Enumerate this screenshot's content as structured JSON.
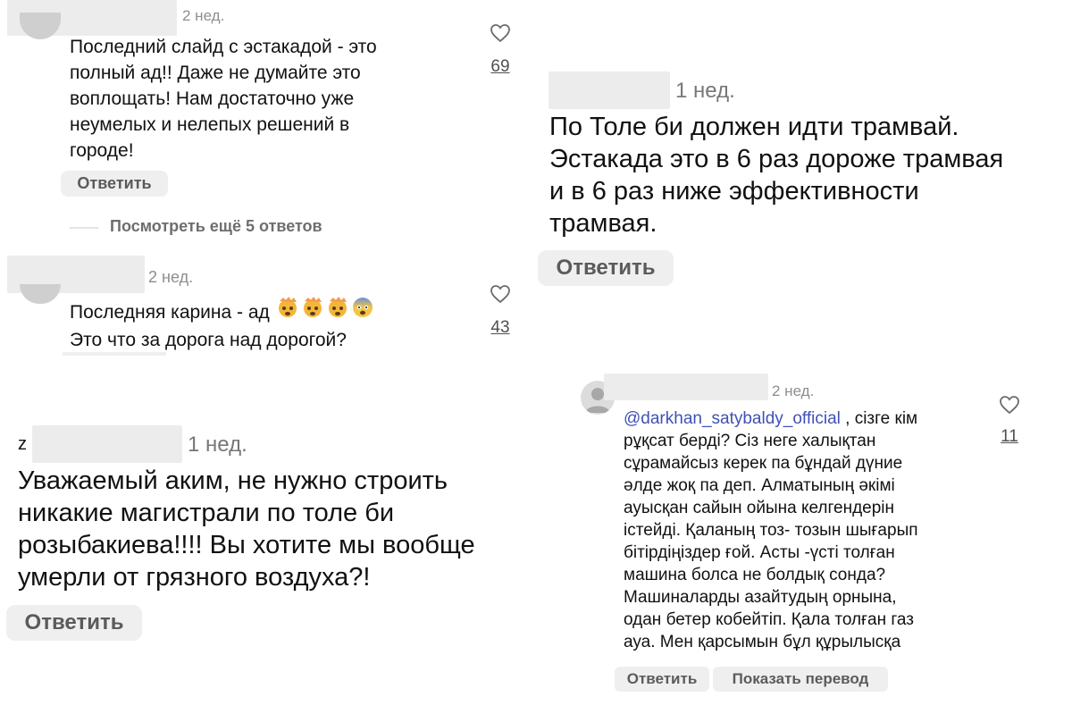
{
  "c1": {
    "time": "2 нед.",
    "lines": [
      "Последний слайд с эстакадой - это",
      "полный ад!! Даже не думайте это",
      "воплощать! Нам достаточно уже",
      "неумелых и нелепых решений в",
      "городе!"
    ],
    "likes": "69",
    "reply": "Ответить",
    "more_replies": "Посмотреть ещё 5 ответов"
  },
  "c2": {
    "time": "2 нед.",
    "line1": "Последняя карина - ад",
    "line2": "Это что за дорога над дорогой?",
    "likes": "43",
    "emojis": [
      "exploding-head",
      "exploding-head",
      "exploding-head",
      "fearful-face"
    ]
  },
  "c3": {
    "name_fragment_left": "z",
    "name_fragment_right": "   ",
    "time": "1 нед.",
    "lines": [
      "Уважаемый аким, не нужно строить",
      "никакие магистрали по толе би",
      "розыбакиева!!!! Вы хотите мы вообще",
      "умерли от грязного воздуха?!"
    ],
    "reply": "Ответить"
  },
  "c4": {
    "time": "1 нед.",
    "lines": [
      "По Толе би должен идти трамвай.",
      "Эстакада это в 6 раз дороже трамвая",
      "и в 6 раз ниже эффективности",
      "трамвая."
    ],
    "reply": "Ответить"
  },
  "c5": {
    "time": "2 нед.",
    "mention": "@darkhan_satybaldy_official",
    "first_line_rest": " , сізге кім",
    "lines": [
      "рұқсат берді? Сіз неге халықтан",
      "сұрамайсыз керек па бұндай дүние",
      "әлде жоқ па деп. Алматының әкімі",
      "ауысқан сайын ойына келгендерін",
      "істейді. Қаланың тоз- тозын шығарып",
      "бітірдіңіздер ғой. Асты -үсті толған",
      "машина болса не болдық сонда?",
      "Машиналарды азайтудың орнына,",
      "одан бетер кобейтіп. Қала толған газ",
      "ауа. Мен қарсымын бұл құрылысқа"
    ],
    "likes": "11",
    "reply": "Ответить",
    "translate": "Показать перевод",
    "mention_color": "#3f51b5"
  },
  "icons": {
    "like": "heart-icon",
    "avatar": "avatar"
  }
}
